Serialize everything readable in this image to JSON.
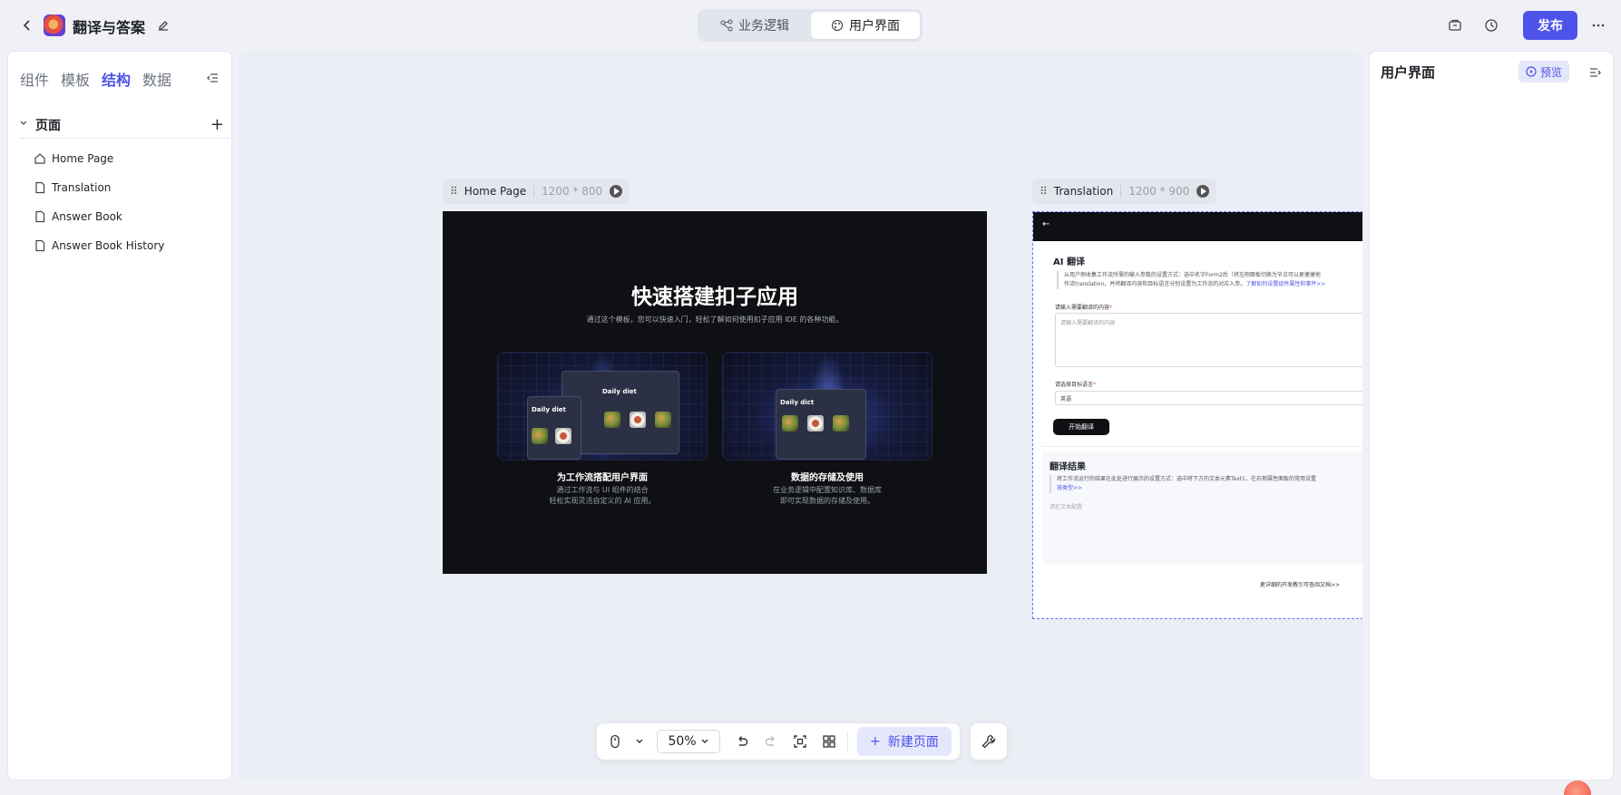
{
  "header": {
    "app_title": "翻译与答案",
    "mode_tabs": [
      {
        "label": "业务逻辑",
        "active": false
      },
      {
        "label": "用户界面",
        "active": true
      }
    ],
    "publish_label": "发布"
  },
  "left_panel": {
    "tabs": [
      {
        "label": "组件",
        "active": false
      },
      {
        "label": "模板",
        "active": false
      },
      {
        "label": "结构",
        "active": true
      },
      {
        "label": "数据",
        "active": false
      }
    ],
    "pages_label": "页面",
    "pages": [
      {
        "label": "Home Page",
        "icon": "home-icon"
      },
      {
        "label": "Translation",
        "icon": "file-icon"
      },
      {
        "label": "Answer Book",
        "icon": "file-icon"
      },
      {
        "label": "Answer Book History",
        "icon": "file-icon"
      }
    ]
  },
  "canvas": {
    "home_frame": {
      "name": "Home Page",
      "size": "1200 * 800",
      "title": "快速搭建扣子应用",
      "subtitle": "通过这个模板，您可以快速入门，轻松了解如何使用扣子应用 IDE 的各种功能。",
      "cards": [
        {
          "caption": "为工作流搭配用户界面",
          "desc1": "通过工作流与 UI 组件的结合",
          "desc2": "轻松实现灵活自定义的 AI 应用。",
          "mock_text": "Daily diet"
        },
        {
          "caption": "数据的存储及使用",
          "desc1": "在业务逻辑中配置知识库、数据库",
          "desc2": "即可实现数据的存储及使用。",
          "mock_text": "Daily dict"
        }
      ]
    },
    "translation_frame": {
      "name": "Translation",
      "size": "1200 * 900",
      "back_glyph": "←",
      "heading": "AI 翻译",
      "note_line1": "从用户侧收集工作流所需的输入参数的设置方式：选中名字Form2后（将左侧面板切换为节点可以更便捷地",
      "note_line2": "作流translation，并将翻译内容和目标语言分别设置为工作流的对应入参。",
      "note_link": "了解如何设置组件属性和事件>>",
      "input_label": "请输入需要翻译的内容",
      "input_placeholder": "请输入需要翻译的内容",
      "lang_label": "请选择目标语言",
      "lang_value": "英语",
      "start_button": "开始翻译",
      "result_heading": "翻译结果",
      "result_note_line1": "将工作流运行的结果在此处进行展示的设置方式：选中将下方的文本元素Text1，在右侧属性面板的常用设置",
      "result_note_link": "容类型>>",
      "result_placeholder": "请在文本配置",
      "footer_link": "更详细的开发教引可查阅文档>>"
    }
  },
  "bottom_toolbar": {
    "zoom_label": "50%",
    "new_page_label": "新建页面"
  },
  "right_panel": {
    "title": "用户界面",
    "preview_label": "预览"
  },
  "colors": {
    "accent": "#4d53e8",
    "dark_frame": "#0f1014"
  }
}
